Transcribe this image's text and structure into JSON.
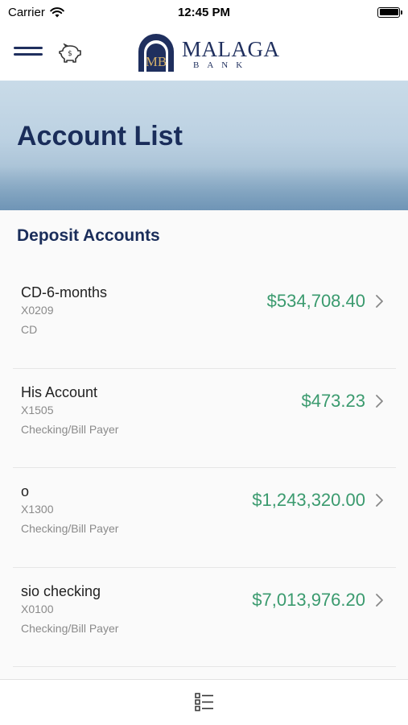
{
  "status_bar": {
    "carrier": "Carrier",
    "time": "12:45 PM"
  },
  "header": {
    "logo_name": "MALAGA",
    "logo_sub": "BANK",
    "logo_monogram": "MB",
    "brand_color": "#1f2f5e",
    "icons": [
      "menu-icon",
      "piggy-bank-icon"
    ]
  },
  "banner": {
    "title": "Account List"
  },
  "section": {
    "title": "Deposit Accounts"
  },
  "accounts": [
    {
      "name": "CD-6-months",
      "number": "X0209",
      "type": "CD",
      "balance": "$534,708.40"
    },
    {
      "name": "His Account",
      "number": "X1505",
      "type": "Checking/Bill Payer",
      "balance": "$473.23"
    },
    {
      "name": "o",
      "number": "X1300",
      "type": "Checking/Bill Payer",
      "balance": "$1,243,320.00"
    },
    {
      "name": "sio checking",
      "number": "X0100",
      "type": "Checking/Bill Payer",
      "balance": "$7,013,976.20"
    }
  ],
  "colors": {
    "balance": "#3a9a6e",
    "title": "#1a2d5a"
  },
  "tab_bar": {
    "icons": [
      "list-icon"
    ]
  }
}
